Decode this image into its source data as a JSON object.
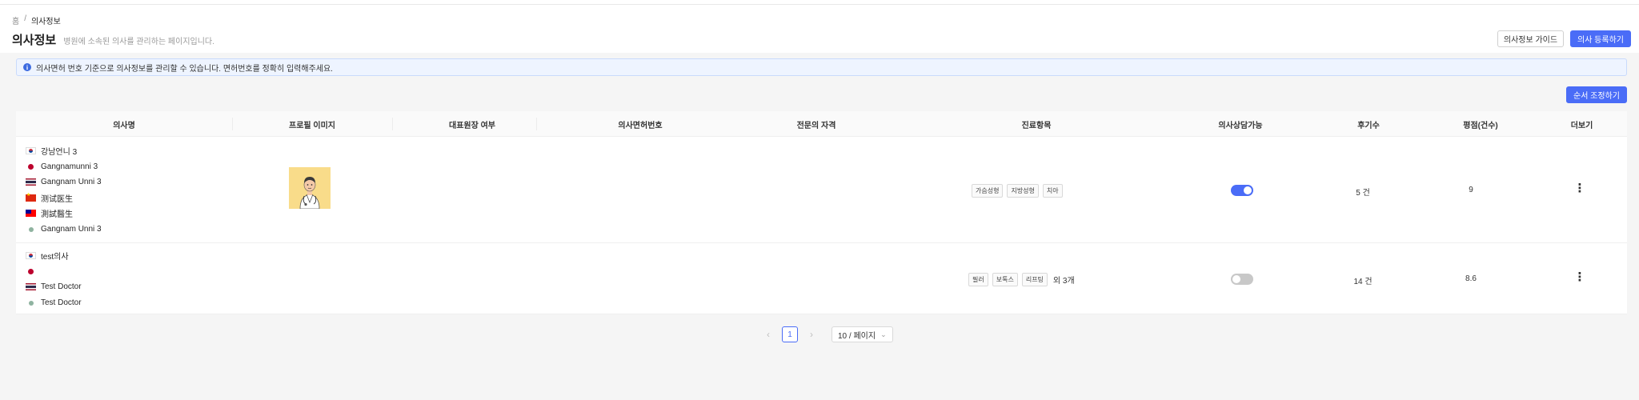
{
  "breadcrumb": {
    "home": "홈",
    "separator": "/",
    "current": "의사정보"
  },
  "page": {
    "title": "의사정보",
    "subtitle": "병원에 소속된 의사를 관리하는 페이지입니다.",
    "guide_button": "의사정보 가이드",
    "register_button": "의사 등록하기"
  },
  "info": {
    "icon": "info-icon",
    "text": "의사면허 번호 기준으로 의사정보를 관리할 수 있습니다. 면허번호를 정확히 입력해주세요."
  },
  "order_button": "순서 조정하기",
  "columns": [
    "의사명",
    "프로필 이미지",
    "대표원장 여부",
    "의사면허번호",
    "전문의 자격",
    "진료항목",
    "의사상담가능",
    "후기수",
    "평점(건수)",
    "더보기"
  ],
  "rows": [
    {
      "names": [
        {
          "flag": "kr-flag-icon",
          "text": "강남언니 3"
        },
        {
          "flag": "jp-flag-icon",
          "text": "Gangnamunni 3"
        },
        {
          "flag": "th-flag-icon",
          "text": "Gangnam Unni 3"
        },
        {
          "flag": "cn-flag-icon",
          "text": "测试医生"
        },
        {
          "flag": "tw-flag-icon",
          "text": "測試醫生"
        },
        {
          "flag": "globe-dot-icon",
          "text": "Gangnam Unni 3"
        }
      ],
      "has_avatar": true,
      "treatments": [
        "가슴성형",
        "지방성형",
        "치아"
      ],
      "treatments_more": "",
      "consult_enabled": true,
      "review_count": "5 건",
      "rating": "9"
    },
    {
      "names": [
        {
          "flag": "kr-flag-icon",
          "text": "test의사"
        },
        {
          "flag": "jp-flag-icon",
          "text": ""
        },
        {
          "flag": "th-flag-icon",
          "text": "Test Doctor"
        },
        {
          "flag": "globe-dot-icon",
          "text": "Test Doctor"
        }
      ],
      "has_avatar": false,
      "treatments": [
        "필러",
        "보톡스",
        "리프팅"
      ],
      "treatments_more": "외 3개",
      "consult_enabled": false,
      "review_count": "14 건",
      "rating": "8.6"
    }
  ],
  "pagination": {
    "prev": "‹",
    "current_page": "1",
    "next": "›",
    "page_size": "10 / 페이지"
  }
}
